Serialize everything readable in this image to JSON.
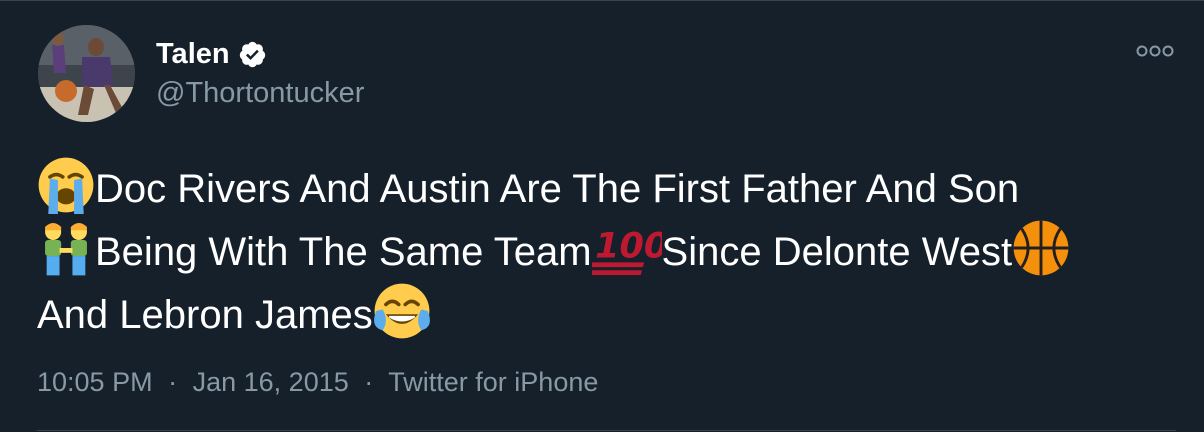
{
  "author": {
    "display_name": "Talen",
    "handle": "@Thortontucker",
    "verified": true
  },
  "tweet": {
    "lines": [
      [
        {
          "type": "emoji",
          "name": "loudly-crying-face-emoji"
        },
        {
          "type": "text",
          "text": "Doc Rivers And Austin Are The First Father And Son"
        }
      ],
      [
        {
          "type": "emoji",
          "name": "two-men-holding-hands-emoji"
        },
        {
          "type": "text",
          "text": "Being With The Same Team"
        },
        {
          "type": "emoji",
          "name": "hundred-points-emoji"
        },
        {
          "type": "text",
          "text": "Since Delonte West"
        },
        {
          "type": "emoji",
          "name": "basketball-emoji"
        }
      ],
      [
        {
          "type": "text",
          "text": "And Lebron James"
        },
        {
          "type": "emoji",
          "name": "face-with-tears-of-joy-emoji"
        }
      ]
    ]
  },
  "meta": {
    "time": "10:05 PM",
    "date": "Jan 16, 2015",
    "source": "Twitter for iPhone",
    "separator": "·"
  },
  "icons": {
    "verified": "verified-badge-icon",
    "more": "more-options-icon"
  },
  "colors": {
    "background": "#15202b",
    "text_primary": "#ffffff",
    "text_secondary": "#8899a6",
    "border": "#38444d"
  }
}
